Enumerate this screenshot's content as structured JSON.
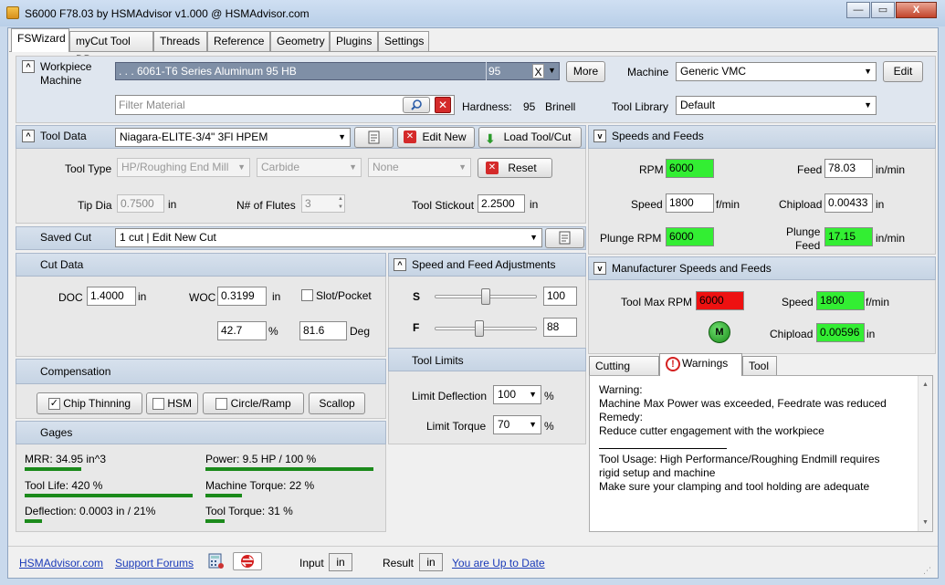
{
  "window": {
    "title": "S6000 F78.03 by HSMAdvisor v1.000 @ HSMAdvisor.com",
    "minimize": "—",
    "maximize": "▭",
    "close": "X"
  },
  "tabs": [
    "FSWizard",
    "myCut Tool DB",
    "Threads",
    "Reference",
    "Geometry",
    "Plugins",
    "Settings"
  ],
  "workpiece": {
    "label_line1": "Workpiece",
    "label_line2": "Machine",
    "material": " . . . 6061-T6 Series Aluminum 95 HB",
    "hb": "95",
    "clear": "X",
    "more_button": "More",
    "filter_placeholder": "Filter Material",
    "hardness_label": "Hardness:",
    "hardness_value": "95",
    "hardness_unit": "Brinell",
    "machine_label": "Machine",
    "machine_value": "Generic VMC",
    "edit_button": "Edit",
    "tool_library_label": "Tool Library",
    "tool_library_value": "Default"
  },
  "tool_data": {
    "header": "Tool Data",
    "tool_name": "Niagara-ELITE-3/4\" 3Fl  HPEM",
    "edit_new_button": "Edit New",
    "load_button": "Load Tool/Cut",
    "tool_type_label": "Tool Type",
    "tool_type_value": "HP/Roughing End Mill",
    "material_value": "Carbide",
    "coating_value": "None",
    "reset_button": "Reset",
    "tip_dia_label": "Tip Dia",
    "tip_dia_value": "0.7500",
    "tip_dia_unit": "in",
    "flutes_label": "N# of Flutes",
    "flutes_value": "3",
    "stickout_label": "Tool Stickout",
    "stickout_value": "2.2500",
    "stickout_unit": "in"
  },
  "saved_cut": {
    "label": "Saved Cut",
    "value": "1 cut | Edit New Cut"
  },
  "cut_data": {
    "header": "Cut Data",
    "doc_label": "DOC",
    "doc_value": "1.4000",
    "doc_unit": "in",
    "woc_label": "WOC",
    "woc_value": "0.3199",
    "woc_unit": "in",
    "slot_label": "Slot/Pocket",
    "pct_value": "42.7",
    "pct_unit": "%",
    "deg_value": "81.6",
    "deg_unit": "Deg"
  },
  "adjust": {
    "header": "Speed and Feed Adjustments",
    "s_label": "S",
    "s_value": "100",
    "s_level": 0.5,
    "f_label": "F",
    "f_value": "88",
    "f_level": 0.44
  },
  "limits": {
    "header": "Tool Limits",
    "deflection_label": "Limit Deflection",
    "deflection_value": "100",
    "torque_label": "Limit Torque",
    "torque_value": "70",
    "unit": "%"
  },
  "compensation": {
    "header": "Compensation",
    "chip_thinning": "Chip Thinning",
    "chip_thinning_checked": true,
    "chip_check_mark": "✓",
    "hsm": "HSM",
    "circle": "Circle/Ramp",
    "scallop": "Scallop"
  },
  "gages": {
    "header": "Gages",
    "mrr": "MRR: 34.95 in^3",
    "mrr_level": 0.34,
    "power": "Power: 9.5 HP / 100 %",
    "power_level": 1.0,
    "tool_life": "Tool Life: 420 %",
    "tool_life_level": 1.0,
    "torque": "Machine Torque: 22 %",
    "torque_level": 0.22,
    "deflection": "Deflection: 0.0003 in / 21%",
    "deflection_level": 0.21,
    "tool_torque": "Tool Torque: 31 %",
    "tool_torque_level": 0.31
  },
  "speeds": {
    "header": "Speeds and Feeds",
    "rpm_label": "RPM",
    "rpm_value": "6000",
    "feed_label": "Feed",
    "feed_value": "78.03",
    "feed_unit": "in/min",
    "speed_label": "Speed",
    "speed_value": "1800",
    "speed_unit": "f/min",
    "chipload_label": "Chipload",
    "chipload_value": "0.00433",
    "chipload_unit": "in",
    "plunge_rpm_label": "Plunge RPM",
    "plunge_rpm_value": "6000",
    "plunge_feed_label1": "Plunge",
    "plunge_feed_label2": "Feed",
    "plunge_feed_value": "17.15",
    "plunge_feed_unit": "in/min"
  },
  "manufacturer": {
    "header": "Manufacturer Speeds and Feeds",
    "max_rpm_label": "Tool Max RPM",
    "max_rpm_value": "6000",
    "speed_label": "Speed",
    "speed_value": "1800",
    "speed_unit": "f/min",
    "chipload_label": "Chipload",
    "chipload_value": "0.00596",
    "chipload_unit": "in",
    "m_badge": "M"
  },
  "bottom_tabs": [
    "Cutting Data",
    "Warnings",
    "Tool"
  ],
  "warnings": {
    "l1": "Warning:",
    "l2": "Machine Max Power was exceeded, Feedrate was reduced",
    "l3": "Remedy:",
    "l4": "Reduce cutter engagement with the workpiece",
    "l5": "Tool Usage: High Performance/Roughing Endmill requires",
    "l6": "rigid setup and machine",
    "l7": "Make sure your clamping and tool holding are adequate"
  },
  "footer": {
    "site_link": "HSMAdvisor.com",
    "support_link": "Support Forums",
    "input_label": "Input",
    "input_unit": "in",
    "result_label": "Result",
    "result_unit": "in",
    "update_link": "You are Up to Date"
  },
  "colors": {
    "ok": "#33ee33",
    "alert": "#ee1111",
    "bar": "#1b8a1b",
    "header_bg": "#d0dbe8"
  }
}
